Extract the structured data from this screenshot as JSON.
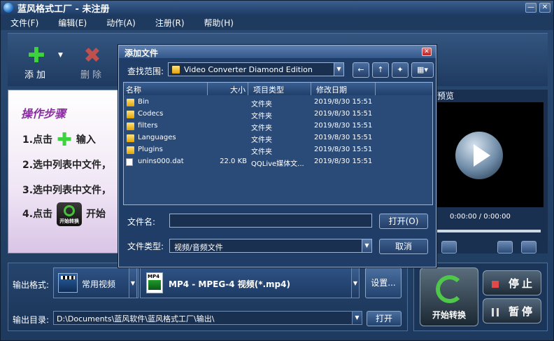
{
  "window": {
    "title": "蓝风格式工厂 - 未注册",
    "min": "—",
    "max": "▭",
    "close": "✕"
  },
  "menu": [
    "文件(F)",
    "编辑(E)",
    "动作(A)",
    "注册(R)",
    "帮助(H)"
  ],
  "toolbar": {
    "add_label": "添加",
    "delete_label": "删除"
  },
  "steps": {
    "title": "操作步骤",
    "step1": "1.点击",
    "step1_suffix": "输入",
    "step2": "2.选中列表中文件，",
    "step3": "3.选中列表中文件，",
    "step4": "4.点击",
    "step4_suffix": "开始",
    "convert_icon_text": "开始转换"
  },
  "preview": {
    "title": "预览",
    "time": "0:00:00 / 0:00:00"
  },
  "output": {
    "format_label": "输出格式:",
    "format_value": "常用视频",
    "detail_value": "MP4 - MPEG-4 视频(*.mp4)",
    "mp4_icon_text": "MP4",
    "settings_button": "设置...",
    "dir_label": "输出目录:",
    "dir_value": "D:\\Documents\\蓝风软件\\蓝风格式工厂\\输出\\",
    "open_button": "打开"
  },
  "convert": {
    "start": "开始转换",
    "stop": "停止",
    "pause": "暂停"
  },
  "dialog": {
    "title": "添加文件",
    "close": "✕",
    "look_in_label": "查找范围:",
    "look_in_value": "Video Converter Diamond Edition",
    "columns": [
      "名称",
      "大小",
      "项目类型",
      "修改日期"
    ],
    "files": [
      {
        "name": "Bin",
        "size": "",
        "type": "文件夹",
        "date": "2019/8/30 15:51",
        "kind": "folder"
      },
      {
        "name": "Codecs",
        "size": "",
        "type": "文件夹",
        "date": "2019/8/30 15:51",
        "kind": "folder"
      },
      {
        "name": "filters",
        "size": "",
        "type": "文件夹",
        "date": "2019/8/30 15:51",
        "kind": "folder"
      },
      {
        "name": "Languages",
        "size": "",
        "type": "文件夹",
        "date": "2019/8/30 15:51",
        "kind": "folder"
      },
      {
        "name": "Plugins",
        "size": "",
        "type": "文件夹",
        "date": "2019/8/30 15:51",
        "kind": "folder"
      },
      {
        "name": "unins000.dat",
        "size": "22.0 KB",
        "type": "QQLive媒体文...",
        "date": "2019/8/30 15:51",
        "kind": "file"
      }
    ],
    "filename_label": "文件名:",
    "filename_value": "",
    "filetype_label": "文件类型:",
    "filetype_value": "视频/音频文件",
    "open_button": "打开(O)",
    "cancel_button": "取消"
  }
}
